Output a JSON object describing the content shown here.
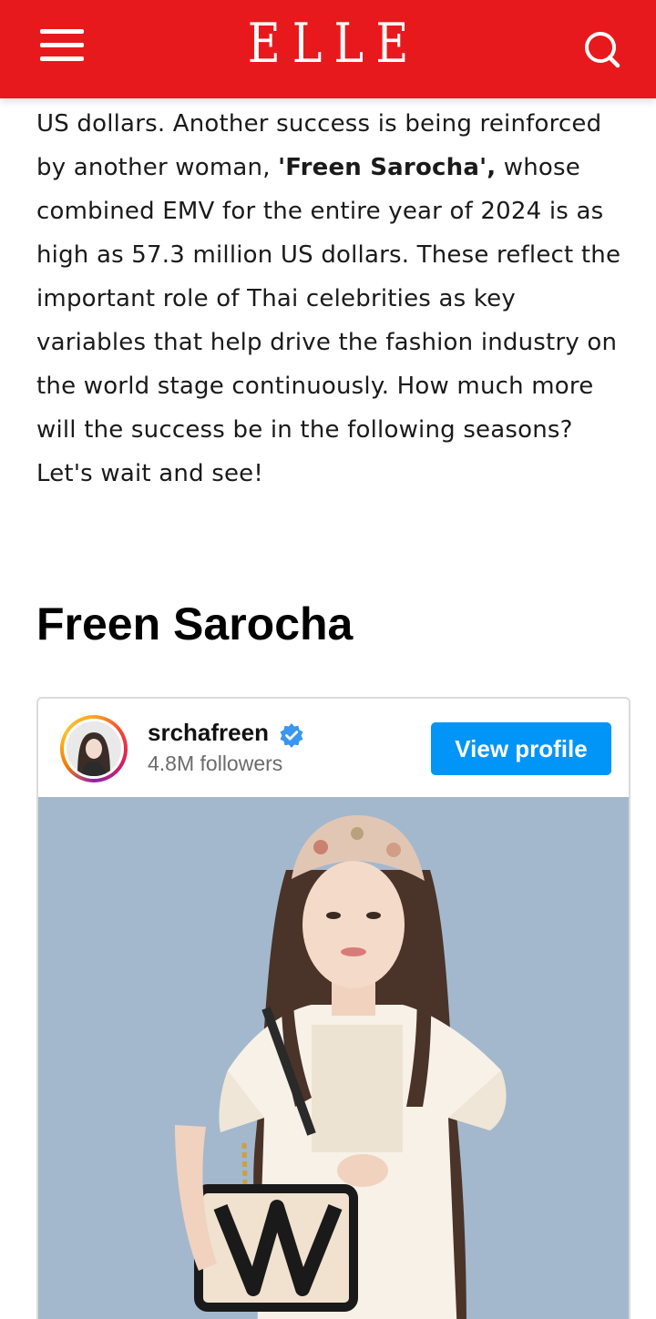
{
  "header": {
    "logo": "ELLE",
    "brand_color": "#e8191c",
    "menu_icon": "hamburger-menu-icon",
    "search_icon": "search-icon"
  },
  "article": {
    "paragraph": {
      "part1": "US dollars. Another success is being reinforced by another woman, ",
      "bold_name": "'Freen Sarocha',",
      "part2": " whose combined EMV for the entire year of 2024 is as high as 57.3 million US dollars. These reflect the important role of Thai celebrities as key variables that help drive the fashion industry on the world stage continuously. How much more will the success be in the following seasons? Let's wait and see!"
    },
    "section_heading": "Freen Sarocha"
  },
  "instagram_embed": {
    "username": "srchafreen",
    "verified": true,
    "followers": "4.8M followers",
    "view_profile_label": "View profile",
    "button_color": "#0095f6"
  }
}
